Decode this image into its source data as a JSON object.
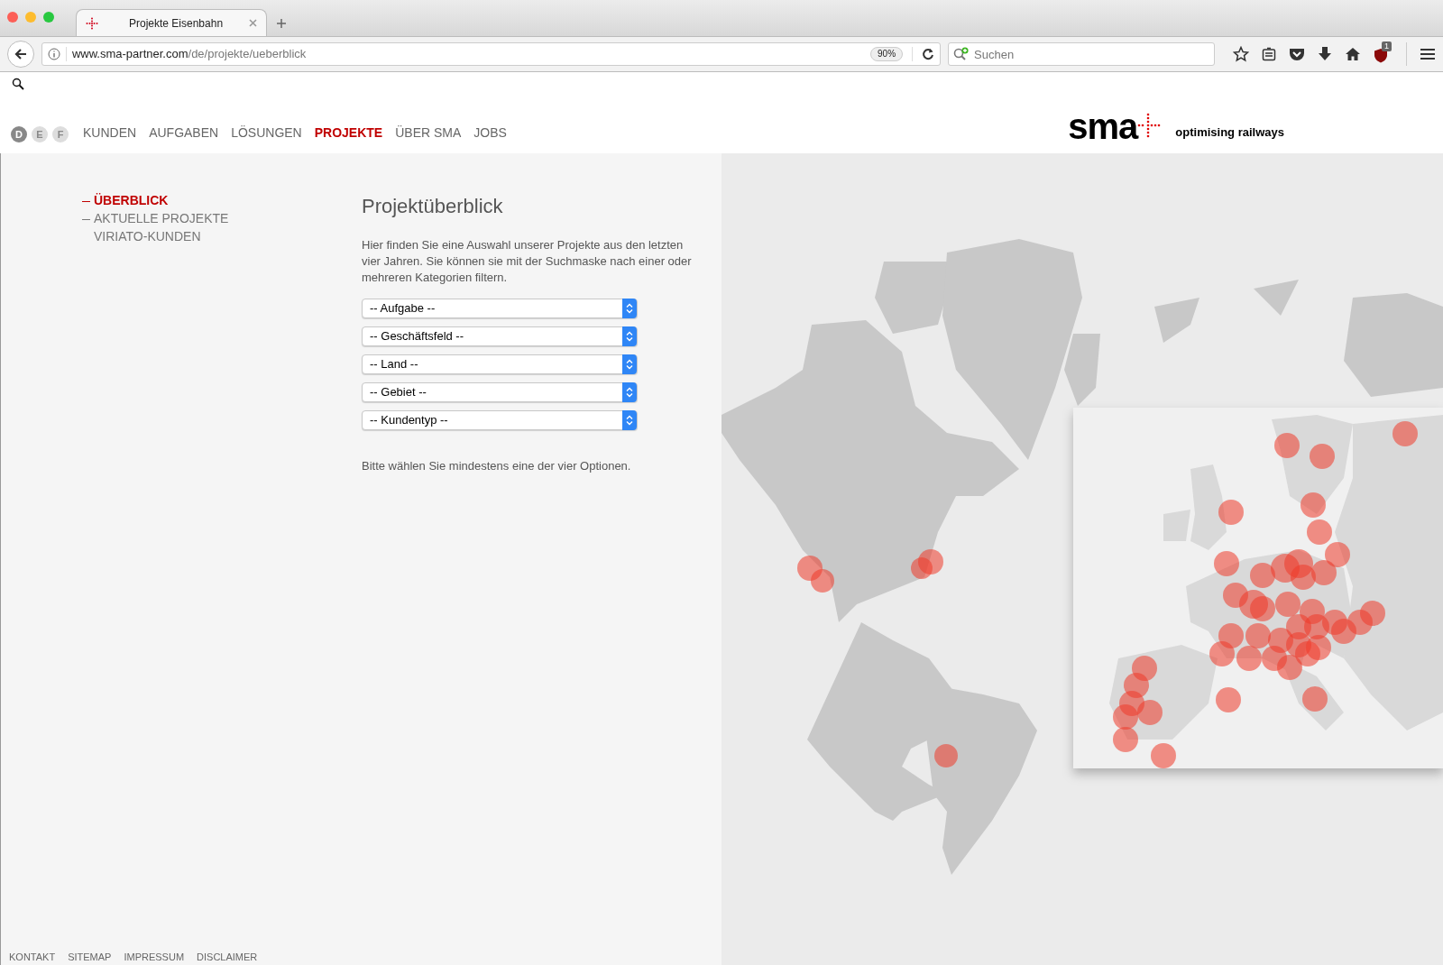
{
  "browser": {
    "tab": {
      "title": "Projekte Eisenbahn"
    },
    "url": {
      "host": "www.sma-partner.com",
      "path": "/de/projekte/ueberblick"
    },
    "zoom": "90%",
    "search": {
      "placeholder": "Suchen"
    },
    "addon_badge": "1"
  },
  "languages": [
    {
      "label": "D",
      "selected": true
    },
    {
      "label": "E",
      "selected": false
    },
    {
      "label": "F",
      "selected": false
    }
  ],
  "nav": [
    {
      "label": "KUNDEN",
      "selected": false
    },
    {
      "label": "AUFGABEN",
      "selected": false
    },
    {
      "label": "LÖSUNGEN",
      "selected": false
    },
    {
      "label": "PROJEKTE",
      "selected": true
    },
    {
      "label": "ÜBER SMA",
      "selected": false
    },
    {
      "label": "JOBS",
      "selected": false
    }
  ],
  "logo": {
    "wordmark": "sma",
    "tagline": "optimising railways"
  },
  "sidebar": [
    {
      "label": "ÜBERBLICK",
      "selected": true,
      "kind": "dashed"
    },
    {
      "label": "AKTUELLE PROJEKTE",
      "selected": false,
      "kind": "dashed"
    },
    {
      "label": "VIRIATO-KUNDEN",
      "selected": false,
      "kind": "plain"
    }
  ],
  "heading": "Projektüberblick",
  "intro": "Hier finden Sie eine Auswahl unserer Projekte aus den letzten vier Jahren. Sie können sie mit der Suchmaske nach einer oder mehreren Kategorien filtern.",
  "filters": [
    {
      "value": "-- Aufgabe --"
    },
    {
      "value": "-- Geschäftsfeld --"
    },
    {
      "value": "-- Land --"
    },
    {
      "value": "-- Gebiet --"
    },
    {
      "value": "-- Kundentyp --"
    }
  ],
  "hint": "Bitte wählen Sie mindestens eine der vier Optionen.",
  "footer": [
    "KONTAKT",
    "SITEMAP",
    "IMPRESSUM",
    "DISCLAIMER"
  ]
}
